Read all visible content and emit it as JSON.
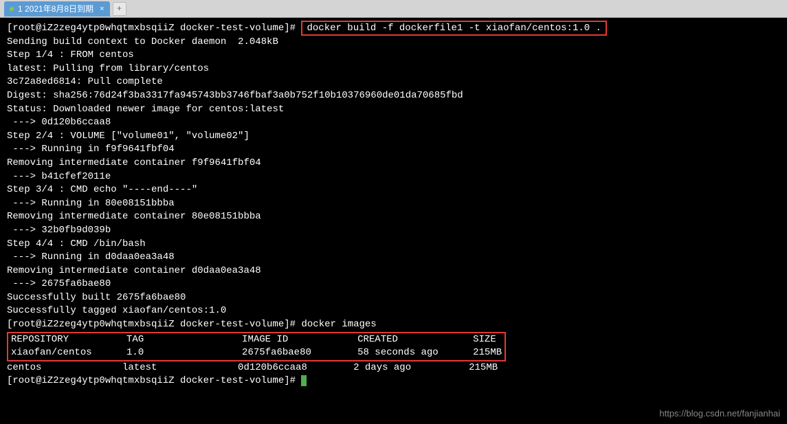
{
  "tab": {
    "title": "1 2021年8月8日到期",
    "close": "×",
    "new": "+"
  },
  "terminal": {
    "prompt1": "[root@iZ2zeg4ytp0whqtmxbsqiiZ docker-test-volume]# ",
    "cmd1": "docker build -f dockerfile1 -t xiaofan/centos:1.0 .",
    "lines": [
      "Sending build context to Docker daemon  2.048kB",
      "Step 1/4 : FROM centos",
      "latest: Pulling from library/centos",
      "3c72a8ed6814: Pull complete",
      "Digest: sha256:76d24f3ba3317fa945743bb3746fbaf3a0b752f10b10376960de01da70685fbd",
      "Status: Downloaded newer image for centos:latest",
      " ---> 0d120b6ccaa8",
      "Step 2/4 : VOLUME [\"volume01\", \"volume02\"]",
      " ---> Running in f9f9641fbf04",
      "Removing intermediate container f9f9641fbf04",
      " ---> b41cfef2011e",
      "Step 3/4 : CMD echo \"----end----\"",
      " ---> Running in 80e08151bbba",
      "Removing intermediate container 80e08151bbba",
      " ---> 32b0fb9d039b",
      "Step 4/4 : CMD /bin/bash",
      " ---> Running in d0daa0ea3a48",
      "Removing intermediate container d0daa0ea3a48",
      " ---> 2675fa6bae80",
      "Successfully built 2675fa6bae80",
      "Successfully tagged xiaofan/centos:1.0"
    ],
    "prompt2": "[root@iZ2zeg4ytp0whqtmxbsqiiZ docker-test-volume]# ",
    "cmd2": "docker images",
    "table": {
      "header": "REPOSITORY          TAG                 IMAGE ID            CREATED             SIZE",
      "row1": "xiaofan/centos      1.0                 2675fa6bae80        58 seconds ago      215MB",
      "row2": "centos              latest              0d120b6ccaa8        2 days ago          215MB"
    },
    "prompt3": "[root@iZ2zeg4ytp0whqtmxbsqiiZ docker-test-volume]# "
  },
  "watermark": "https://blog.csdn.net/fanjianhai"
}
